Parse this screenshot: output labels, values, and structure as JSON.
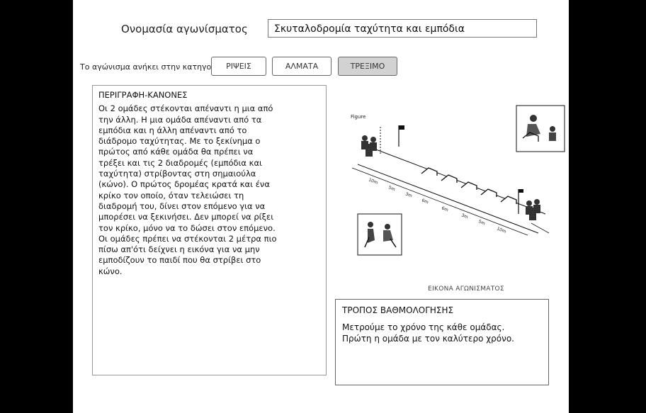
{
  "event": {
    "label": "Ονομασία αγωνίσματος",
    "name": "Σκυταλοδρομία ταχύτητα και εμπόδια"
  },
  "category": {
    "label": "Το αγώνισμα ανήκει στην κατηγορία",
    "options": [
      "ΡΙΨΕΙΣ",
      "ΑΛΜΑΤΑ",
      "ΤΡΕΞΙΜΟ"
    ],
    "selected": "ΤΡΕΞΙΜΟ"
  },
  "description": {
    "title": "ΠΕΡΙΓΡΑΦΗ-ΚΑΝΟΝΕΣ",
    "text": "Οι 2 ομάδες στέκονται απέναντι η μια από\nτην άλλη. Η μια ομάδα απέναντι από τα\nεμπόδια και η άλλη απέναντι από το\nδιάδρομο ταχύτητας. Με το ξεκίνημα ο\nπρώτος από κάθε ομάδα θα πρέπει να\nτρέξει και τις 2 διαδρομές (εμπόδια και\nταχύτητα) στρίβοντας στη σημαιούλα\n(κώνο). Ο πρώτος δρομέας κρατά και ένα\nκρίκο τον οποίο, όταν τελειώσει τη\nδιαδρομή του, δίνει στον επόμενο για να\nμπορέσει να ξεκινήσει. Δεν μπορεί να ρίξει\nτον κρίκο, μόνο να το δώσει στον επόμενο.\nΟι ομάδες πρέπει να στέκονται 2 μέτρα πιο\nπίσω απ'ότι δείχνει η εικόνα για να μην\nεμποδίζουν το παιδί που θα στρίβει στο\nκώνο."
  },
  "figure": {
    "label": "Figure",
    "caption": "ΕΙΚΟΝΑ ΑΓΩΝΙΣΜΑΤΟΣ",
    "distance_labels": [
      "10m",
      "5m",
      "3m",
      "6m",
      "6m",
      "3m",
      "5m",
      "10m"
    ]
  },
  "scoring": {
    "title": "ΤΡΟΠΟΣ ΒΑΘΜΟΛΟΓΗΣΗΣ",
    "text": "Μετρούμε το χρόνο της κάθε ομάδας.\nΠρώτη η ομάδα με τον καλύτερο χρόνο."
  }
}
